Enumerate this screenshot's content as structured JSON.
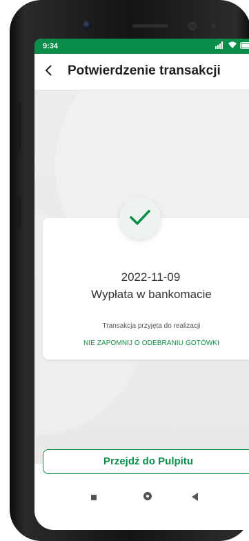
{
  "status_bar": {
    "time": "9:34",
    "icons": [
      "signal-icon",
      "wifi-icon",
      "battery-icon"
    ]
  },
  "header": {
    "back_icon": "chevron-left-icon",
    "title": "Potwierdzenie transakcji"
  },
  "confirmation": {
    "icon": "checkmark-icon",
    "date": "2022-11-09",
    "transaction_name": "Wypłata w bankomacie",
    "status_text": "Transakcja przyjęta do realizacji",
    "reminder_text": "NIE ZAPOMNIJ O ODEBRANIU GOTÓWKI"
  },
  "actions": {
    "primary_label": "Przejdź do Pulpitu"
  },
  "system_nav": {
    "items": [
      "recents-icon",
      "home-icon",
      "back-icon"
    ]
  },
  "colors": {
    "accent": "#0c8e4b",
    "status_bar": "#0c8e4b",
    "background": "#ebebeb"
  }
}
